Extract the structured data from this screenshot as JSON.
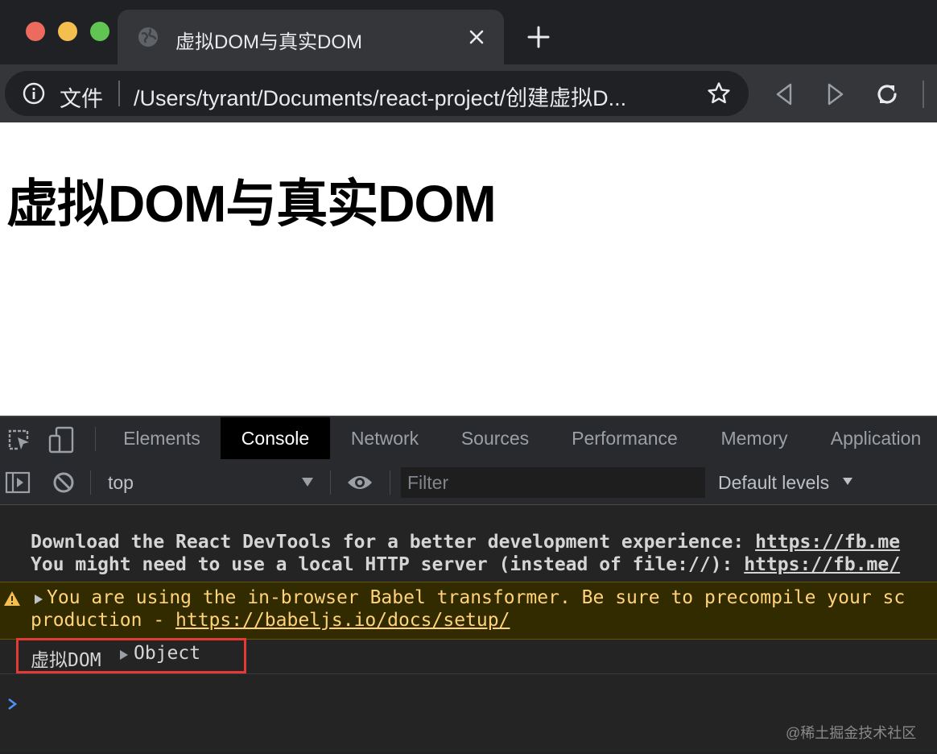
{
  "browser": {
    "tab": {
      "title": "虚拟DOM与真实DOM"
    },
    "omnibox": {
      "origin_label": "文件",
      "url": "/Users/tyrant/Documents/react-project/创建虚拟D..."
    }
  },
  "page": {
    "heading": "虚拟DOM与真实DOM"
  },
  "devtools": {
    "tabs": [
      {
        "label": "Elements"
      },
      {
        "label": "Console"
      },
      {
        "label": "Network"
      },
      {
        "label": "Sources"
      },
      {
        "label": "Performance"
      },
      {
        "label": "Memory"
      },
      {
        "label": "Application"
      }
    ],
    "active_tab": "Console",
    "console_toolbar": {
      "context": "top",
      "filter_placeholder": "Filter",
      "levels": "Default levels"
    },
    "messages": {
      "info_1_text": "Download the React DevTools for a better development experience: ",
      "info_1_link": "https://fb.me",
      "info_2_text": "You might need to use a local HTTP server (instead of file://): ",
      "info_2_link": "https://fb.me/",
      "warning_line_1": "You are using the in-browser Babel transformer. Be sure to precompile your sc",
      "warning_line_2_prefix": "production - ",
      "warning_link": "https://babeljs.io/docs/setup/",
      "log_label": "虚拟DOM",
      "log_object": "Object"
    }
  },
  "watermark": "@稀土掘金技术社区",
  "colors": {
    "chrome_dark": "#202124",
    "chrome_toolbar": "#35363a",
    "devtools_bg": "#242424",
    "warning_bg": "#332b00",
    "warning_text": "#ffd37a",
    "highlight": "#e53935",
    "prompt": "#4f8ff7"
  }
}
